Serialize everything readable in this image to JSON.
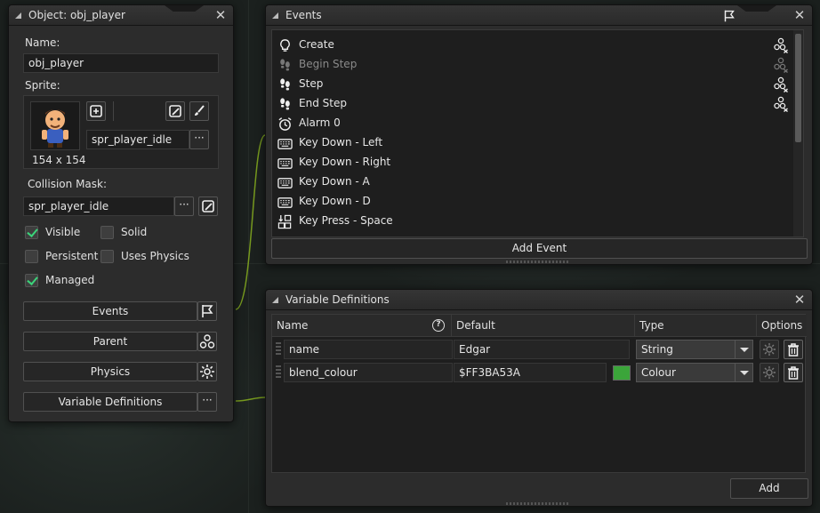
{
  "object_panel": {
    "title": "Object: obj_player",
    "name_label": "Name:",
    "name_value": "obj_player",
    "sprite_label": "Sprite:",
    "sprite_size": "154 x 154",
    "sprite_name": "spr_player_idle",
    "sprite_menu": "···",
    "collision_label": "Collision Mask:",
    "collision_value": "spr_player_idle",
    "collision_menu": "···",
    "checkboxes": [
      {
        "label": "Visible",
        "checked": true
      },
      {
        "label": "Solid",
        "checked": false
      },
      {
        "label": "Persistent",
        "checked": false
      },
      {
        "label": "Uses Physics",
        "checked": false
      },
      {
        "label": "Managed",
        "checked": true
      }
    ],
    "buttons": {
      "events": "Events",
      "parent": "Parent",
      "physics": "Physics",
      "variable_definitions": "Variable Definitions",
      "vardef_menu": "···"
    }
  },
  "events_panel": {
    "title": "Events",
    "events": [
      {
        "label": "Create",
        "icon": "lightbulb-icon",
        "dim": false,
        "inherit": true
      },
      {
        "label": "Begin Step",
        "icon": "footsteps-icon",
        "dim": true,
        "inherit": true
      },
      {
        "label": "Step",
        "icon": "footsteps-icon",
        "dim": false,
        "inherit": true
      },
      {
        "label": "End Step",
        "icon": "footsteps-icon",
        "dim": false,
        "inherit": true
      },
      {
        "label": "Alarm 0",
        "icon": "alarm-clock-icon",
        "dim": false,
        "inherit": false
      },
      {
        "label": "Key Down - Left",
        "icon": "keyboard-icon",
        "dim": false,
        "inherit": false
      },
      {
        "label": "Key Down - Right",
        "icon": "keyboard-icon",
        "dim": false,
        "inherit": false
      },
      {
        "label": "Key Down - A",
        "icon": "keyboard-icon",
        "dim": false,
        "inherit": false
      },
      {
        "label": "Key Down - D",
        "icon": "keyboard-icon",
        "dim": false,
        "inherit": false
      },
      {
        "label": "Key Press - Space",
        "icon": "key-press-icon",
        "dim": false,
        "inherit": false
      }
    ],
    "add_event": "Add Event"
  },
  "variables_panel": {
    "title": "Variable Definitions",
    "columns": {
      "name": "Name",
      "default": "Default",
      "type": "Type",
      "options": "Options"
    },
    "rows": [
      {
        "name": "name",
        "default": "Edgar",
        "type": "String",
        "swatch": ""
      },
      {
        "name": "blend_colour",
        "default": "$FF3BA53A",
        "type": "Colour",
        "swatch": "#3ba53a"
      }
    ],
    "add": "Add"
  },
  "colors": {
    "accent_green": "#3bd47a",
    "colour_swatch": "#3ba53a",
    "curve": "#8db81e"
  }
}
